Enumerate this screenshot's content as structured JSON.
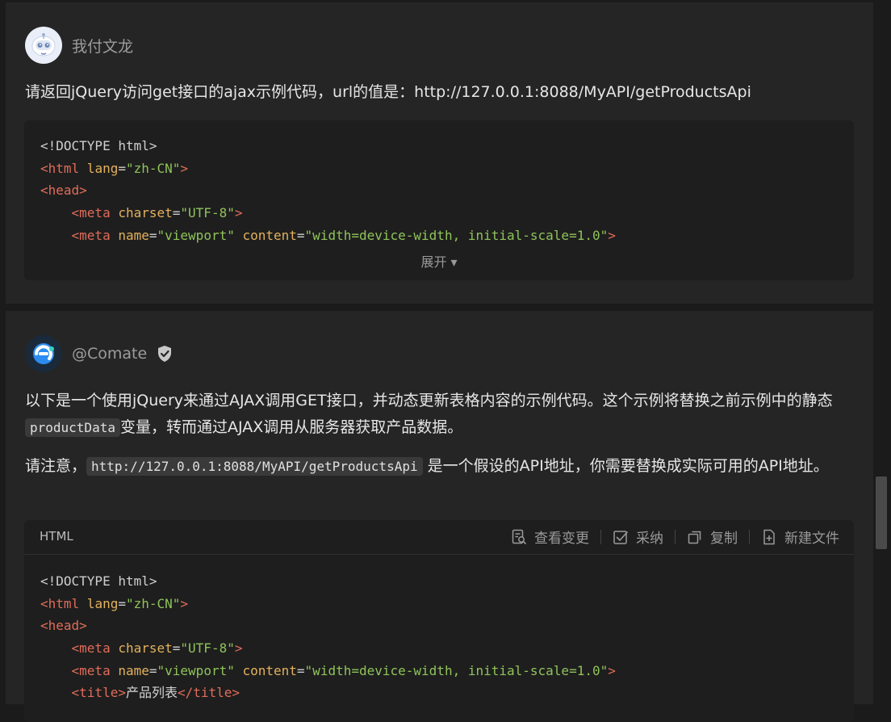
{
  "message1": {
    "username": "我付文龙",
    "question": "请返回jQuery访问get接口的ajax示例代码，url的值是：http://127.0.0.1:8088/MyAPI/getProductsApi",
    "expand_label": "展开 ▾",
    "code": {
      "l1": {
        "p1": "<!DOCTYPE html>"
      },
      "l2": {
        "t1": "<html",
        "a1": " lang",
        "p1": "=",
        "s1": "\"zh-CN\"",
        "t2": ">"
      },
      "l3": {
        "t1": "<head>"
      },
      "l4": {
        "indent": "    ",
        "t1": "<meta",
        "a1": " charset",
        "p1": "=",
        "s1": "\"UTF-8\"",
        "t2": ">"
      },
      "l5": {
        "indent": "    ",
        "t1": "<meta",
        "a1": " name",
        "p1": "=",
        "s1": "\"viewport\"",
        "a2": " content",
        "p2": "=",
        "s2": "\"width=device-width, initial-scale=1.0\"",
        "t2": ">"
      }
    }
  },
  "message2": {
    "username": "@Comate",
    "para1": "以下是一个使用jQuery来通过AJAX调用GET接口，并动态更新表格内容的示例代码。这个示例将替换之前示例中的静态",
    "para1_code": "productData",
    "para1_rest": "变量，转而通过AJAX调用从服务器获取产品数据。",
    "para2_start": "请注意，",
    "para2_code": "http://127.0.0.1:8088/MyAPI/getProductsApi",
    "para2_rest": " 是一个假设的API地址，你需要替换成实际可用的API地址。",
    "code_header": {
      "language": "HTML",
      "view_changes": "查看变更",
      "accept": "采纳",
      "copy": "复制",
      "new_file": "新建文件"
    },
    "code": {
      "l1": {
        "p1": "<!DOCTYPE html>"
      },
      "l2": {
        "t1": "<html",
        "a1": " lang",
        "p1": "=",
        "s1": "\"zh-CN\"",
        "t2": ">"
      },
      "l3": {
        "t1": "<head>"
      },
      "l4": {
        "indent": "    ",
        "t1": "<meta",
        "a1": " charset",
        "p1": "=",
        "s1": "\"UTF-8\"",
        "t2": ">"
      },
      "l5": {
        "indent": "    ",
        "t1": "<meta",
        "a1": " name",
        "p1": "=",
        "s1": "\"viewport\"",
        "a2": " content",
        "p2": "=",
        "s2": "\"width=device-width, initial-scale=1.0\"",
        "t2": ">"
      },
      "l6": {
        "indent": "    ",
        "t1": "<title>",
        "d1": "产品列表",
        "t2": "</title>"
      }
    }
  },
  "icons": {
    "user_avatar": "robot-avatar-icon",
    "bot_avatar": "comate-logo-icon",
    "verified": "shield-check-icon",
    "view_changes": "document-search-icon",
    "accept": "checkbox-check-icon",
    "copy": "copy-icon",
    "new_file": "file-plus-icon"
  },
  "colors": {
    "background": "#1b1b1b",
    "panel": "#252525",
    "code_bg": "#1e1e1e",
    "tag": "#e06c5a",
    "attr": "#e3b15c",
    "string": "#8fc35a"
  }
}
